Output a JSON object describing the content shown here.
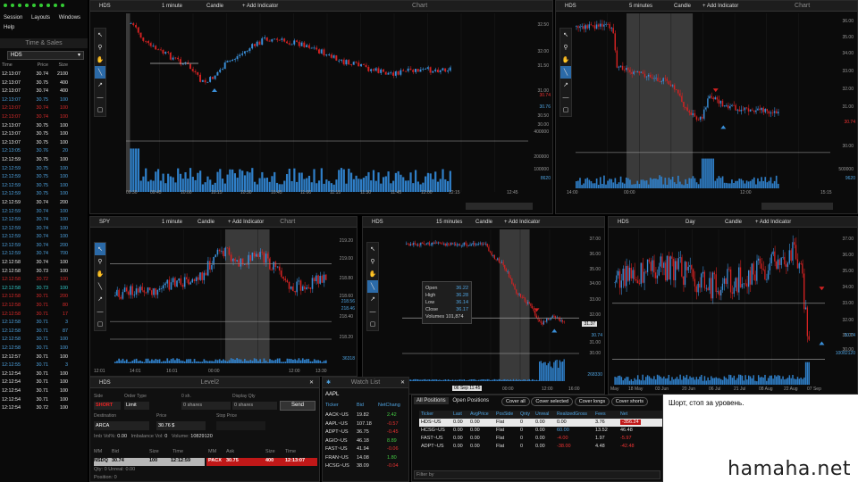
{
  "menu": {
    "items": [
      "Session",
      "Layouts",
      "Windows",
      "Help"
    ]
  },
  "time_sales": {
    "title": "Time & Sales",
    "symbol": "HDS",
    "cols": [
      "Time",
      "Price",
      "Size"
    ],
    "rows": [
      [
        "12:13:07",
        "30.74",
        "2100",
        "white"
      ],
      [
        "12:13:07",
        "30.75",
        "400",
        "white"
      ],
      [
        "12:13:07",
        "30.74",
        "400",
        "white"
      ],
      [
        "12:13:07",
        "30.75",
        "100",
        "blue"
      ],
      [
        "12:13:07",
        "30.74",
        "100",
        "red"
      ],
      [
        "12:13:07",
        "30.74",
        "100",
        "red"
      ],
      [
        "12:13:07",
        "30.75",
        "100",
        "white"
      ],
      [
        "12:13:07",
        "30.75",
        "100",
        "white"
      ],
      [
        "12:13:07",
        "30.75",
        "100",
        "white"
      ],
      [
        "12:13:05",
        "30.76",
        "20",
        "blue"
      ],
      [
        "12:12:59",
        "30.75",
        "100",
        "white"
      ],
      [
        "12:12:59",
        "30.75",
        "100",
        "blue"
      ],
      [
        "12:12:59",
        "30.75",
        "100",
        "blue"
      ],
      [
        "12:12:59",
        "30.75",
        "100",
        "blue"
      ],
      [
        "12:12:59",
        "30.75",
        "100",
        "blue"
      ],
      [
        "12:12:59",
        "30.74",
        "200",
        "white"
      ],
      [
        "12:12:59",
        "30.74",
        "100",
        "blue"
      ],
      [
        "12:12:59",
        "30.74",
        "100",
        "blue"
      ],
      [
        "12:12:59",
        "30.74",
        "100",
        "blue"
      ],
      [
        "12:12:59",
        "30.74",
        "100",
        "blue"
      ],
      [
        "12:12:59",
        "30.74",
        "200",
        "blue"
      ],
      [
        "12:12:59",
        "30.74",
        "700",
        "blue"
      ],
      [
        "12:12:58",
        "30.74",
        "100",
        "white"
      ],
      [
        "12:12:58",
        "30.73",
        "100",
        "white"
      ],
      [
        "12:12:58",
        "30.72",
        "100",
        "red"
      ],
      [
        "12:12:58",
        "30.73",
        "100",
        "cyan"
      ],
      [
        "12:12:58",
        "30.71",
        "200",
        "red"
      ],
      [
        "12:12:58",
        "30.71",
        "80",
        "red"
      ],
      [
        "12:12:58",
        "30.71",
        "17",
        "red"
      ],
      [
        "12:12:58",
        "30.71",
        "3",
        "blue"
      ],
      [
        "12:12:58",
        "30.71",
        "87",
        "blue"
      ],
      [
        "12:12:58",
        "30.71",
        "100",
        "blue"
      ],
      [
        "12:12:58",
        "30.71",
        "100",
        "blue"
      ],
      [
        "12:12:57",
        "30.71",
        "100",
        "white"
      ],
      [
        "12:12:55",
        "30.71",
        "3",
        "blue"
      ],
      [
        "12:12:54",
        "30.71",
        "100",
        "white"
      ],
      [
        "12:12:54",
        "30.71",
        "100",
        "white"
      ],
      [
        "12:12:54",
        "30.71",
        "100",
        "white"
      ],
      [
        "12:12:54",
        "30.71",
        "100",
        "white"
      ],
      [
        "12:12:54",
        "30.72",
        "100",
        "white"
      ]
    ]
  },
  "chart1": {
    "symbol": "HDS",
    "interval": "1 minute",
    "type": "Candle",
    "add": "+ Add Indicator",
    "title": "Chart",
    "yticks": [
      "32.50",
      "32.00",
      "31.50",
      "31.00",
      "30.50",
      "30.00"
    ],
    "vticks": [
      "400000",
      "200000",
      "100000"
    ],
    "last": "30.74",
    "last2": "30.76",
    "vol": "8620",
    "xticks": [
      "09:30",
      "09:45",
      "10:00",
      "10:15",
      "10:30",
      "10:45",
      "11:00",
      "11:15",
      "11:30",
      "11:45",
      "12:00",
      "12:15",
      "12:45"
    ]
  },
  "chart2": {
    "symbol": "HDS",
    "interval": "5 minutes",
    "type": "Candle",
    "add": "+ Add Indicator",
    "title": "Chart",
    "yticks": [
      "36.00",
      "35.00",
      "34.00",
      "33.00",
      "32.00",
      "31.00",
      "30.00"
    ],
    "vticks": [
      "500000"
    ],
    "last": "30.74",
    "vol": "9620",
    "xticks": [
      "14:00",
      "00:00",
      "12:00",
      "15:15"
    ]
  },
  "chart3": {
    "symbol": "SPY",
    "interval": "1 minute",
    "type": "Candle",
    "add": "+ Add Indicator",
    "title": "Chart",
    "yticks": [
      "219.20",
      "219.00",
      "218.80",
      "218.60",
      "218.40",
      "218.20"
    ],
    "last": "218.56",
    "last2": "218.46",
    "vol": "36318",
    "xticks": [
      "12:01",
      "14:01",
      "16:01",
      "00:00",
      "12:00",
      "13:30"
    ]
  },
  "chart4": {
    "symbol": "HDS",
    "interval": "15 minutes",
    "type": "Candle",
    "add": "+ Add Indicator",
    "yticks": [
      "37.00",
      "36.00",
      "35.00",
      "34.00",
      "33.00",
      "32.00",
      "31.00",
      "30.00"
    ],
    "last": "30.74",
    "vol": "268330",
    "cross": "31.37",
    "ohlc": {
      "open_l": "Open",
      "open": "36.22",
      "high_l": "High",
      "high": "36.28",
      "low_l": "Low",
      "low": "36.14",
      "close_l": "Close",
      "close": "36.17",
      "vol_l": "Volumes",
      "vol": "101,874"
    },
    "date_tip": "06 Sep 11:45",
    "xticks": [
      "00:00",
      "12:00",
      "16:00"
    ]
  },
  "chart5": {
    "symbol": "HDS",
    "interval": "Day",
    "type": "Candle",
    "add": "+ Add Indicator",
    "yticks": [
      "37.00",
      "36.00",
      "35.00",
      "34.00",
      "33.00",
      "32.00",
      "31.00",
      "30.00"
    ],
    "last": "30.74",
    "vol": "10082120",
    "xticks": [
      "May",
      "18 May",
      "03 Jun",
      "20 Jun",
      "06 Jul",
      "21 Jul",
      "08 Aug",
      "22 Aug",
      "07 Sep"
    ]
  },
  "level2": {
    "symbol": "HDS",
    "title": "Level2",
    "side_l": "Side",
    "side": "SHORT",
    "otype_l": "Order Type",
    "otype": "Limit",
    "qty_l": "0 sh.",
    "qty": "0 shares",
    "disp_l": "Display Qty",
    "disp": "0 shares",
    "send": "Send",
    "dest_l": "Destination",
    "dest": "ARCA",
    "price_l": "Price",
    "price": "30.76 $",
    "stop_l": "Stop Price",
    "stop": "",
    "info": [
      "Imb Vol%:",
      "0.00",
      "Imbalance Vol:",
      "0",
      "Volume:",
      "10829120"
    ],
    "cols": [
      "MM",
      "Bid",
      "Size",
      "Time",
      "MM",
      "Ask",
      "Size",
      "Time"
    ],
    "bid": [
      "NSDQ",
      "30.74",
      "100",
      "12:12:59"
    ],
    "ask": [
      "PACX",
      "30.75",
      "400",
      "12:13:07"
    ],
    "qty_row": "Qty: 0  Unreal: 0.00",
    "pos_row": "Position: 0"
  },
  "watch": {
    "title": "Watch List",
    "symbol": "AAPL",
    "cols": [
      "Ticker",
      "Bid",
      "NetChang"
    ],
    "rows": [
      [
        "AACK~US",
        "19.82",
        "2.42"
      ],
      [
        "AAPL~US",
        "107.18",
        "-0.57"
      ],
      [
        "ADPT~US",
        "36.75",
        "-0.45"
      ],
      [
        "AGIO~US",
        "46.18",
        "8.89"
      ],
      [
        "FAST~US",
        "41.94",
        "-0.06"
      ],
      [
        "FRAN~US",
        "14.08",
        "1.80"
      ],
      [
        "HCSG~US",
        "38.09",
        "-0.04"
      ]
    ]
  },
  "positions": {
    "tabs": [
      "All Positions",
      "Open Positions"
    ],
    "buttons": [
      "Cover all",
      "Cover selected",
      "Cover longs",
      "Cover shorts"
    ],
    "cols": [
      "Ticker",
      "Last",
      "AvgPrice",
      "PosSide",
      "Qnty",
      "Unreal",
      "RealizedGross",
      "Fees",
      "Net"
    ],
    "rows": [
      [
        "HDS~US",
        "0.00",
        "0.00",
        "Flat",
        "0",
        "0.00",
        "0.00",
        "3.76",
        "-356.24"
      ],
      [
        "HCSG~US",
        "0.00",
        "0.00",
        "Flat",
        "0",
        "0.00",
        "60.00",
        "13.52",
        "46.48"
      ],
      [
        "FAST~US",
        "0.00",
        "0.00",
        "Flat",
        "0",
        "0.00",
        "-4.00",
        "1.97",
        "-5.97"
      ],
      [
        "ADPT~US",
        "0.00",
        "0.00",
        "Flat",
        "0",
        "0.00",
        "-38.00",
        "4.48",
        "-42.48"
      ]
    ],
    "filter": "Filter by"
  },
  "note": "Шорт, стоп за уровень.",
  "brand": "hamaha.net"
}
